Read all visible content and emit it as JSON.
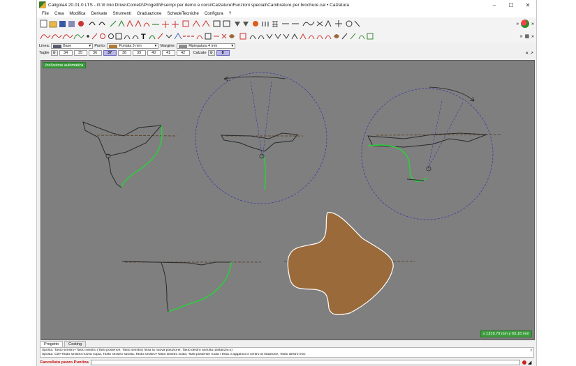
{
  "window": {
    "title": "Caligola4 20.01.0 LTS - G:\\Il mio Drive\\Cometz\\Progetti\\Esempi per demo e corsi\\Calzature\\Funzioni speciali\\Cambrature per brochure.cal • Calzatura",
    "minimize": "–",
    "maximize": "☐",
    "close": "✕"
  },
  "menu": [
    "File",
    "Crea",
    "Modifica",
    "Derivate",
    "Strumenti",
    "Graduazione",
    "SchedeTecniche",
    "Configura",
    "?"
  ],
  "options": {
    "line_label": "Linea:",
    "line_value": "Base",
    "line_color": "#5a5a6e",
    "point_label": "Punto:",
    "point_value": "Puntata 3 mm",
    "point_color": "#b07a3a",
    "margin_label": "Margine:",
    "margin_value": "Ripiegatura 4 mm",
    "margin_color": "#8a8a8a"
  },
  "sizes": {
    "label": "Taglie",
    "values": [
      "34",
      "35",
      "36",
      "37",
      "38",
      "39",
      "40",
      "41",
      "42"
    ],
    "selected": "37",
    "calzate_label": "Calzate",
    "calzate_value": "8",
    "close_glyph": "✕ ↗"
  },
  "canvas": {
    "badge": "Inclusione automatica",
    "coords": "x 1316.79 mm  y 65.16 mm",
    "sole_color": "#9a6a3a",
    "curve_color": "#2ecc40",
    "line_color": "#2a2a2a",
    "guide_color": "#3333aa"
  },
  "tabs": [
    "Progetto",
    "Costing"
  ],
  "messages": [
    "Sposta. Tasto sinistro+Tasto sinistro (Tasti posteriori, Tasto sinistro) fissa la nuova posizione, Tasto destro annulla (distanza=x)",
    "Sposta. Ctrl+Tasto sinistro nuova copia, Tasto sinistro sposta, Tasto sinistro+Tasto sinistro scala, Tasti posteriori ruota / fissa o aggancia il centro di rotazione, Tasto destro esci"
  ],
  "status": {
    "label": "Cancellato pezzo Puntina",
    "input_value": ""
  }
}
